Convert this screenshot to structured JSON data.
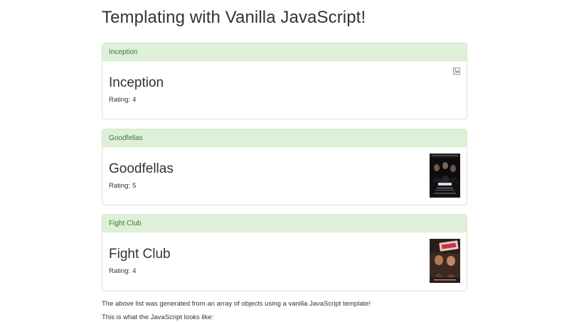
{
  "page": {
    "title": "Templating with Vanilla JavaScript!"
  },
  "movies": [
    {
      "heading": "Inception",
      "title": "Inception",
      "rating_label": "Rating:",
      "rating": "4",
      "poster": "broken-image"
    },
    {
      "heading": "Goodfellas",
      "title": "Goodfellas",
      "rating_label": "Rating:",
      "rating": "5",
      "poster": "goodfellas-poster"
    },
    {
      "heading": "Fight Club",
      "title": "Fight Club",
      "rating_label": "Rating:",
      "rating": "4",
      "poster": "fight-club-poster"
    }
  ],
  "footer": {
    "line1": "The above list was generated from an array of objects using a vanilla JavaScript template!",
    "line2": "This is what the JavaScript looks like:"
  },
  "colors": {
    "panel_heading_bg": "#dff0d8",
    "panel_border": "#d6e9c6",
    "panel_heading_text": "#3c763d"
  }
}
